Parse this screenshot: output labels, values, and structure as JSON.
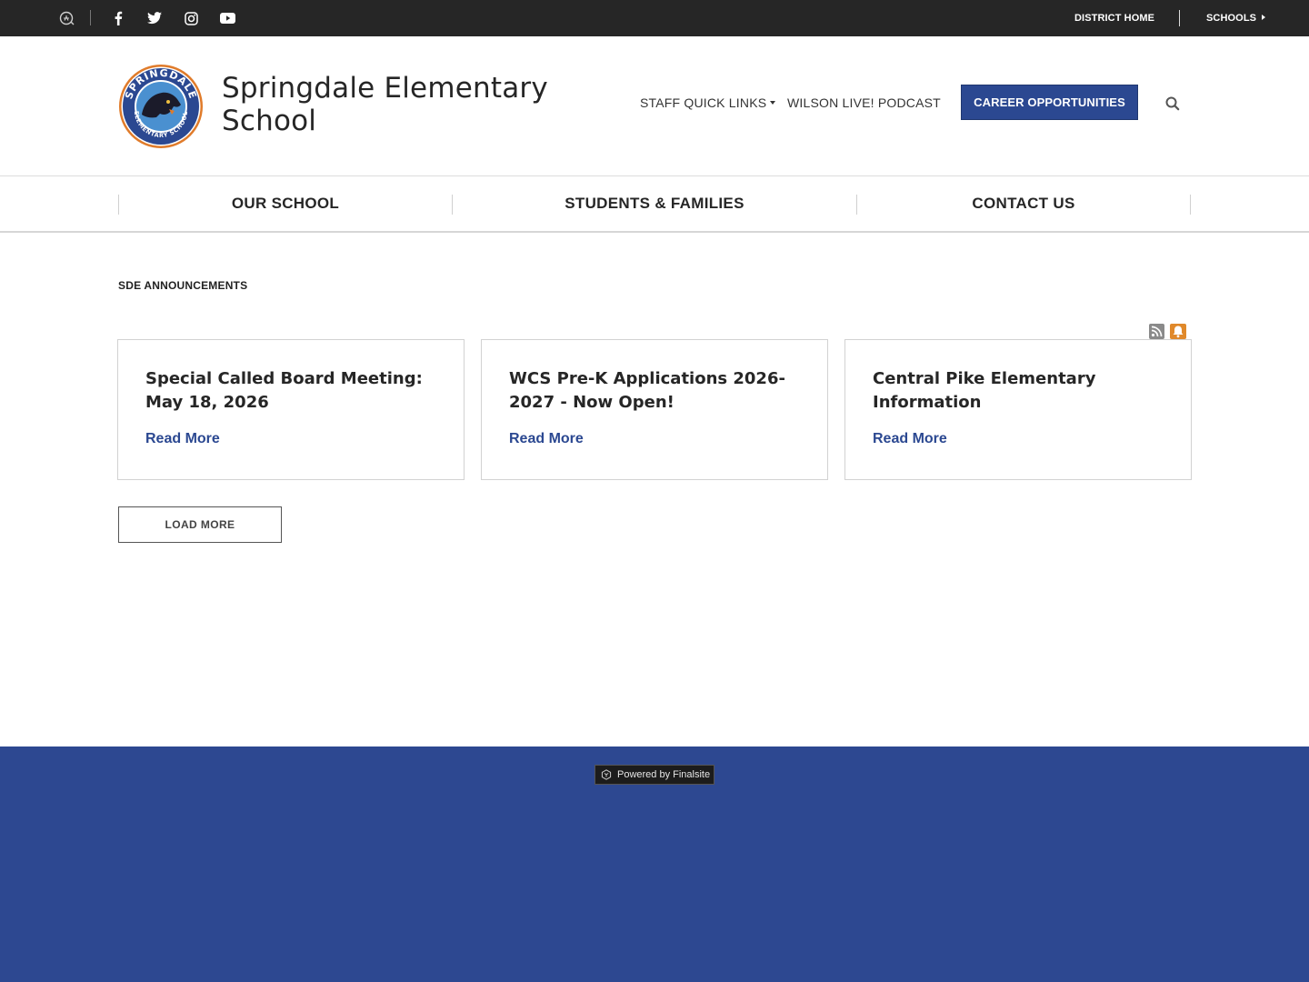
{
  "topbar": {
    "icons": [
      "translate-icon",
      "facebook-icon",
      "twitter-icon",
      "instagram-icon",
      "youtube-icon"
    ],
    "district_home": "DISTRICT HOME",
    "schools": "SCHOOLS"
  },
  "header": {
    "school_name": "Springdale Elementary School",
    "logo_text": "SPRINGDALE ELEMENTARY SCHOOL",
    "staff_quick_links": "STAFF QUICK LINKS",
    "podcast": "WILSON LIVE! PODCAST",
    "career": "CAREER OPPORTUNITIES"
  },
  "nav": {
    "items": [
      {
        "label": "OUR SCHOOL"
      },
      {
        "label": "STUDENTS & FAMILIES"
      },
      {
        "label": "CONTACT US"
      }
    ]
  },
  "announcements": {
    "title": "SDE ANNOUNCEMENTS",
    "cards": [
      {
        "title": "Special Called Board Meeting: May 18, 2026",
        "link": "Read More"
      },
      {
        "title": "WCS Pre-K Applications 2026-2027 - Now Open!",
        "link": "Read More"
      },
      {
        "title": "Central Pike Elementary Information",
        "link": "Read More"
      }
    ],
    "load_more": "LOAD MORE"
  },
  "footer": {
    "powered_by": "Powered by Finalsite"
  },
  "colors": {
    "brand_blue": "#2b4891",
    "topbar_bg": "#262626",
    "footer_bg": "#2d4891",
    "bell_orange": "#e0892b"
  }
}
